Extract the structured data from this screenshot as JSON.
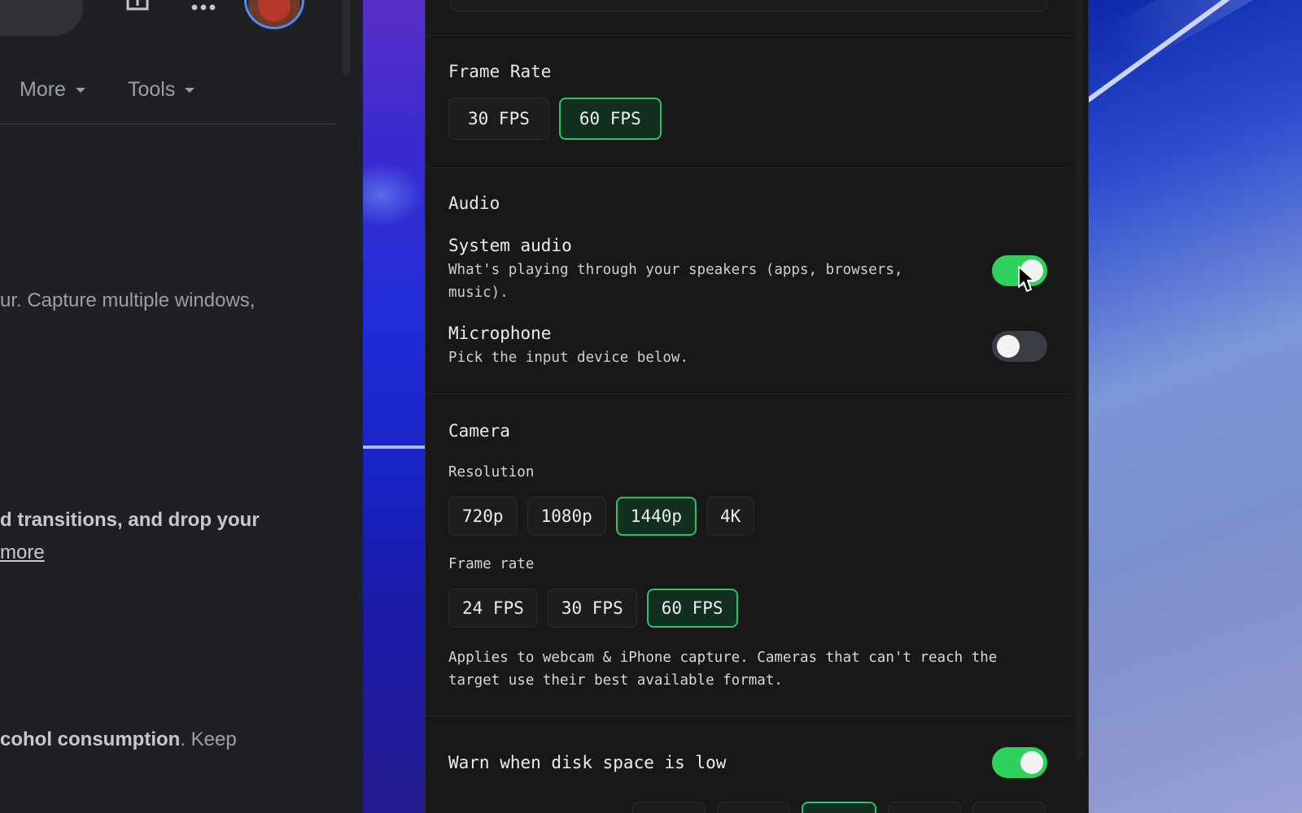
{
  "browser": {
    "nav": [
      {
        "label": "More"
      },
      {
        "label": "Tools"
      }
    ],
    "snippets": [
      {
        "plain_before": "",
        "bold": "",
        "plain_after": "ur. Capture multiple windows,"
      },
      {
        "plain_before": "",
        "bold": "d transitions, and drop your",
        "plain_after": ""
      },
      {
        "link": "more"
      },
      {
        "plain_before": "",
        "bold": "cohol consumption",
        "plain_after": ". Keep"
      }
    ]
  },
  "settings": {
    "frame_rate": {
      "title": "Frame Rate",
      "options": [
        "30 FPS",
        "60 FPS"
      ],
      "selected": "60 FPS"
    },
    "audio": {
      "title": "Audio",
      "system_audio": {
        "label": "System audio",
        "description": "What's playing through your speakers (apps, browsers, music).",
        "enabled": true
      },
      "microphone": {
        "label": "Microphone",
        "description": "Pick the input device below.",
        "enabled": false
      }
    },
    "camera": {
      "title": "Camera",
      "resolution_label": "Resolution",
      "resolution_options": [
        "720p",
        "1080p",
        "1440p",
        "4K"
      ],
      "resolution_selected": "1440p",
      "frame_rate_label": "Frame rate",
      "frame_rate_options": [
        "24 FPS",
        "30 FPS",
        "60 FPS"
      ],
      "frame_rate_selected": "60 FPS",
      "note": "Applies to webcam & iPhone capture. Cameras that can't reach the target use their best available format."
    },
    "disk_warning": {
      "label": "Warn when disk space is low",
      "enabled": true
    }
  },
  "colors": {
    "accent": "#2fc06a",
    "toggle_on": "#2ed15c",
    "panel_bg": "#181818"
  },
  "icons": [
    "search-icon",
    "upload-icon",
    "apps-grid-icon",
    "caret-down-icon",
    "mouse-cursor-icon"
  ]
}
